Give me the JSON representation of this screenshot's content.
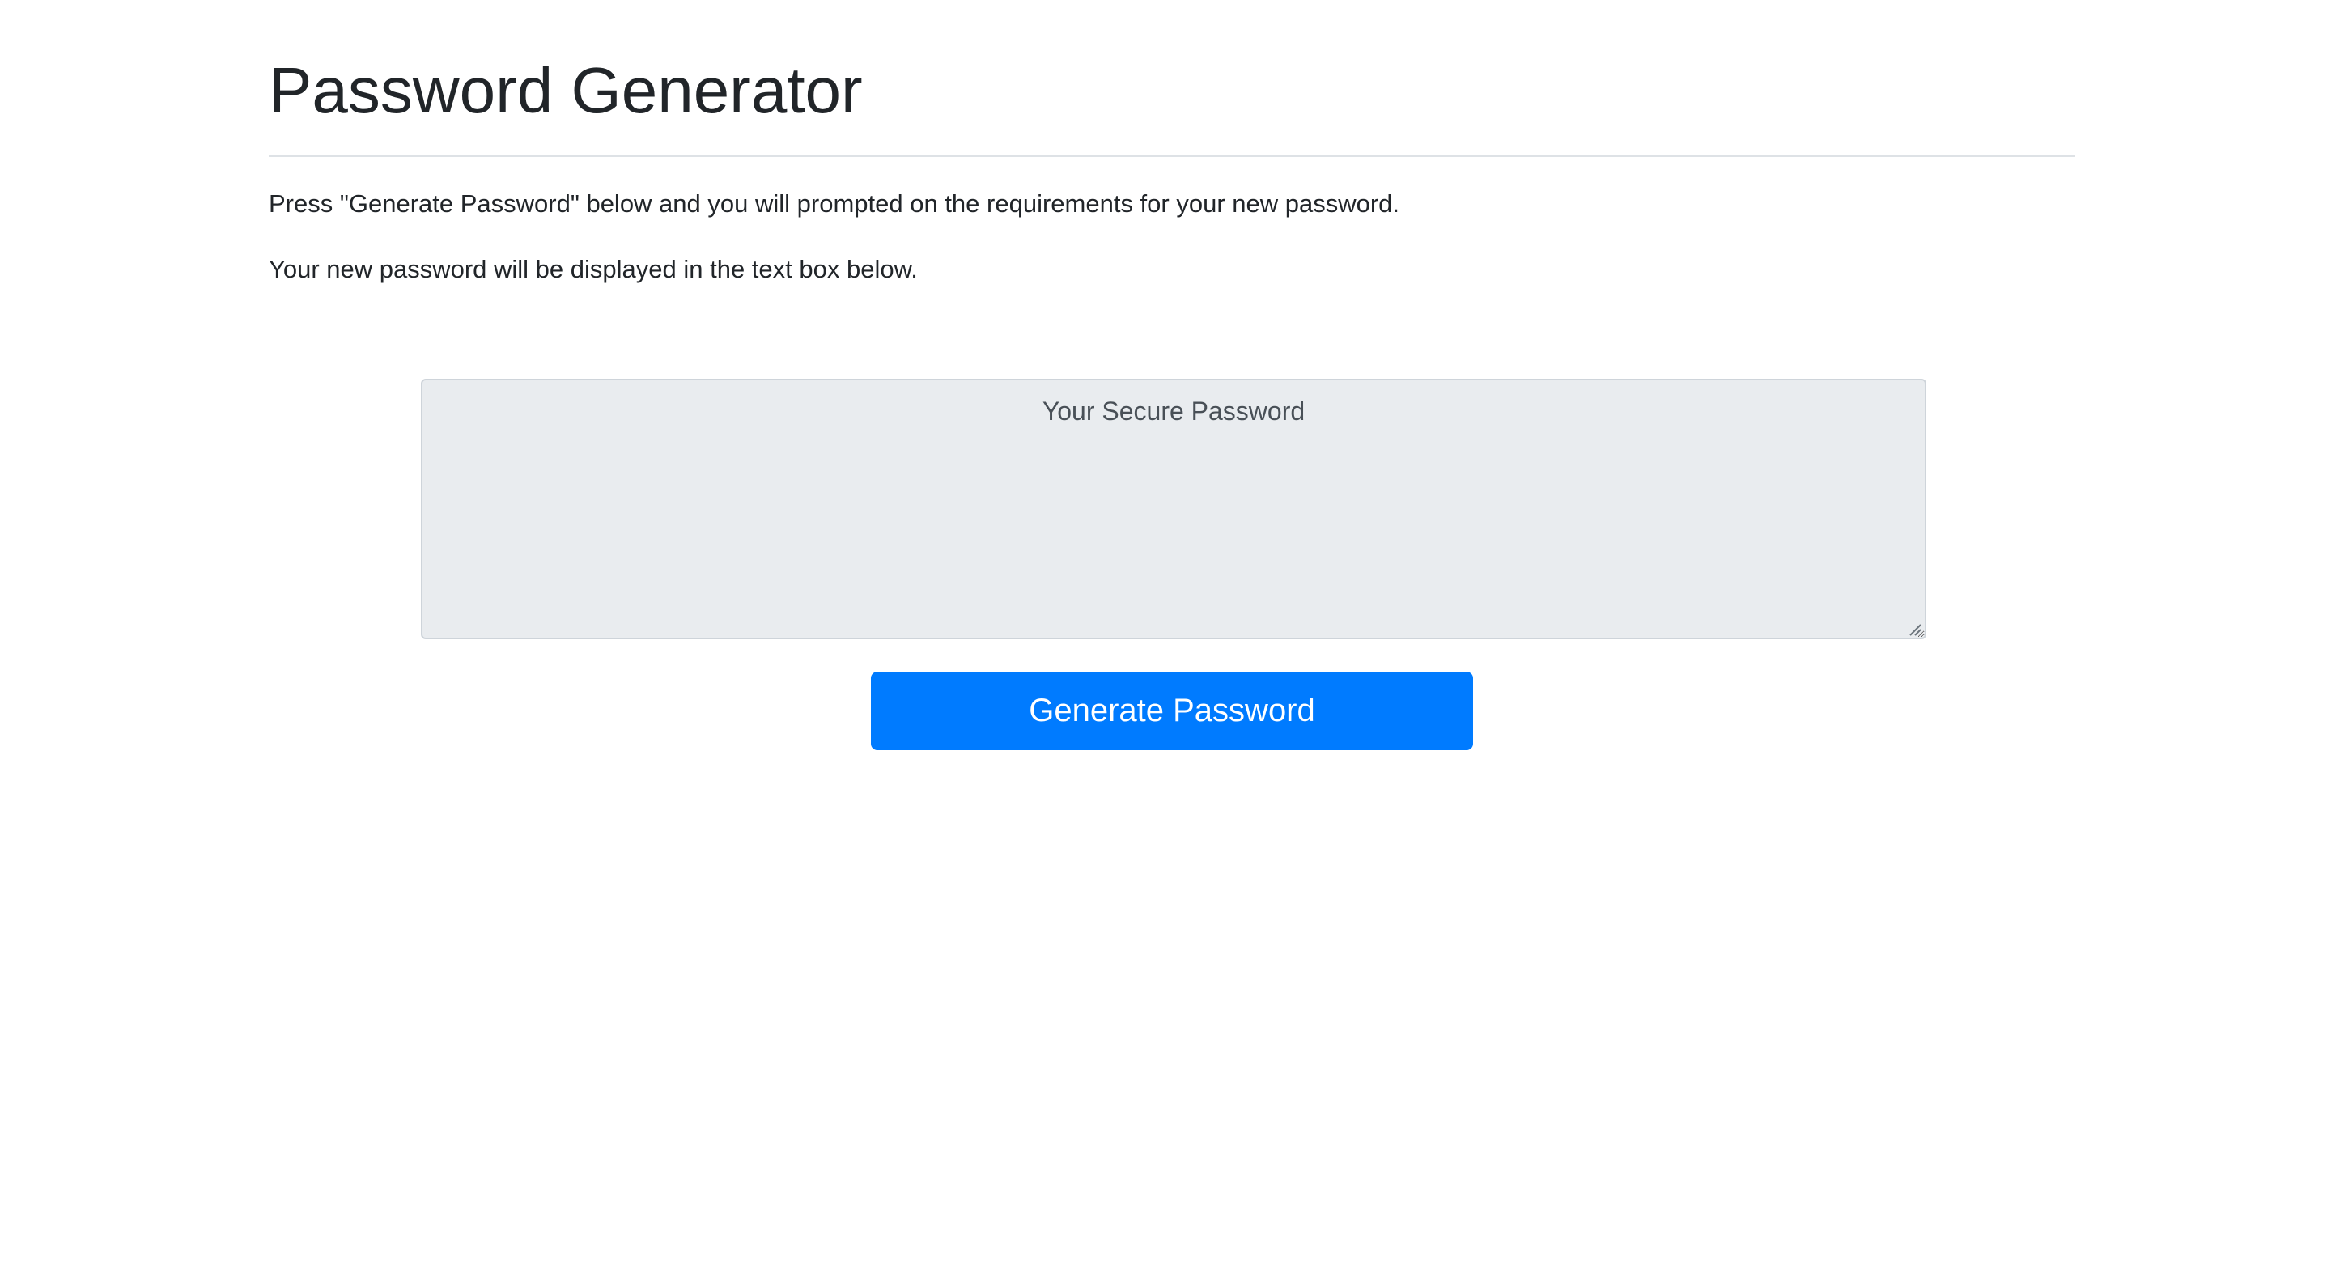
{
  "header": {
    "title": "Password Generator"
  },
  "instructions": {
    "line1": "Press \"Generate Password\" below and you will prompted on the requirements for your new password.",
    "line2": "Your new password will be displayed in the text box below."
  },
  "password_box": {
    "placeholder": "Your Secure Password",
    "value": ""
  },
  "actions": {
    "generate_label": "Generate Password"
  },
  "colors": {
    "primary": "#007bff",
    "text": "#212529",
    "textarea_bg": "#e9ecef",
    "textarea_border": "#ced4da",
    "divider": "#dee2e6"
  },
  "icons": {
    "textarea_resize": "resize-grip-icon"
  }
}
